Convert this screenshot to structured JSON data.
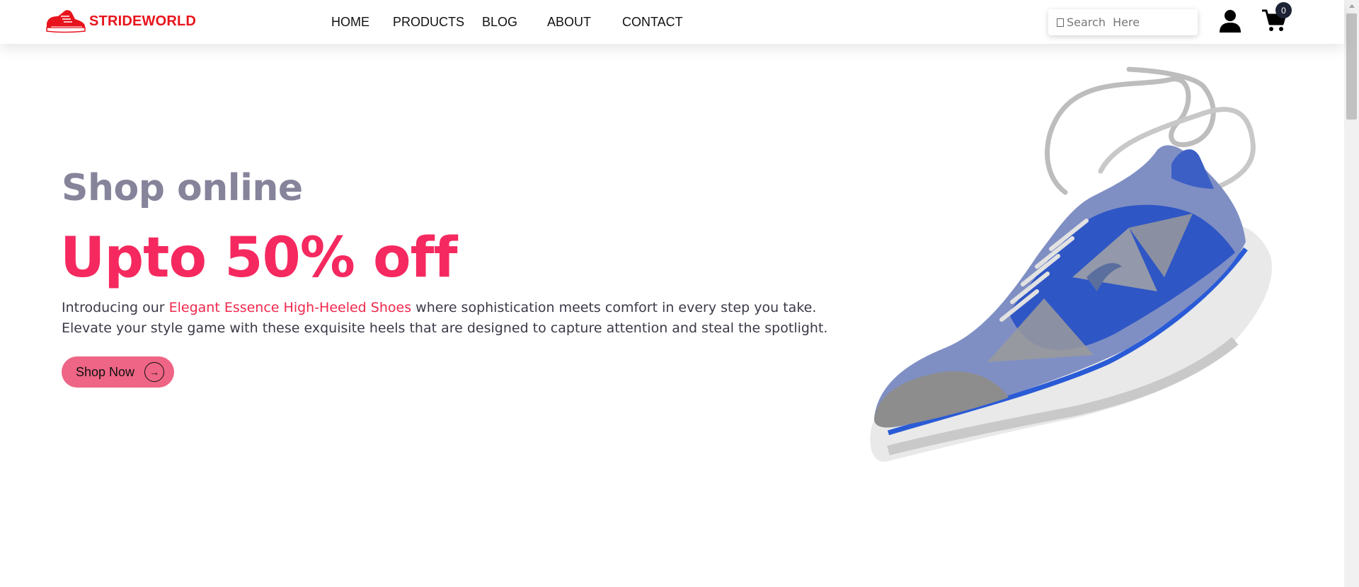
{
  "brand": {
    "name": "STRIDEWORLD",
    "color": "#e8141d"
  },
  "nav": {
    "items": [
      {
        "label": "HOME"
      },
      {
        "label": "PRODUCTS"
      },
      {
        "label": "BLOG"
      },
      {
        "label": "ABOUT"
      },
      {
        "label": "CONTACT"
      }
    ]
  },
  "search": {
    "placeholder": "Search  Here",
    "value": ""
  },
  "cart": {
    "count": "0"
  },
  "hero": {
    "subtitle": "Shop online",
    "title": "Upto 50% off",
    "desc_before": "Introducing our ",
    "desc_accent": "Elegant Essence High-Heeled Shoes",
    "desc_after": " where sophistication meets comfort in every step you take. Elevate your style game with these exquisite heels that are designed to capture attention and steal the spotlight.",
    "button_label": "Shop Now"
  },
  "colors": {
    "accent": "#f5295f",
    "button": "#ee6585",
    "subtitle": "#86849b",
    "badge": "#1e2235"
  },
  "icons": {
    "logo": "sneaker-logo-icon",
    "search": "search-icon",
    "user": "user-icon",
    "cart": "cart-icon",
    "arrow": "arrow-right-circle-icon"
  }
}
